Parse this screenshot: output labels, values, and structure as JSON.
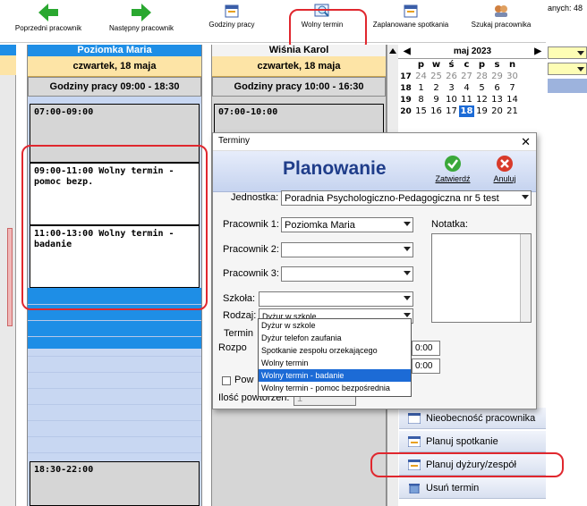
{
  "toolbar": {
    "prev_label": "Poprzedni pracownik",
    "next_label": "Następny pracownik",
    "hours_label": "Godziny pracy",
    "free_label": "Wolny termin",
    "planned_label": "Zaplanowane spotkania",
    "search_label": "Szukaj pracownika"
  },
  "user_count_fragment": "anych: 48",
  "columns": [
    {
      "name": "Poziomka Maria",
      "date": "czwartek, 18 maja",
      "hours": "Godziny pracy 09:00 - 18:30"
    },
    {
      "name": "Wiśnia Karol",
      "date": "czwartek, 18 maja",
      "hours": "Godziny pracy 10:00 - 16:30"
    }
  ],
  "slots": {
    "s1": "07:00-09:00",
    "s2": "09:00-11:00 Wolny termin - pomoc bezp.",
    "s3": "11:00-13:00 Wolny termin - badanie",
    "s4": "18:30-22:00",
    "s5": "07:00-10:00"
  },
  "calendar": {
    "month": "maj 2023",
    "day_headers": [
      "p",
      "w",
      "ś",
      "c",
      "p",
      "s",
      "n"
    ],
    "weeks": [
      {
        "wk": "17",
        "days": [
          "24",
          "25",
          "26",
          "27",
          "28",
          "29",
          "30"
        ]
      },
      {
        "wk": "18",
        "days": [
          "1",
          "2",
          "3",
          "4",
          "5",
          "6",
          "7"
        ]
      },
      {
        "wk": "19",
        "days": [
          "8",
          "9",
          "10",
          "11",
          "12",
          "13",
          "14"
        ]
      },
      {
        "wk": "20",
        "days": [
          "15",
          "16",
          "17",
          "18",
          "19",
          "20",
          "21"
        ]
      }
    ],
    "selected": "18"
  },
  "dialog": {
    "window_title": "Terminy",
    "heading": "Planowanie",
    "ok_label": "Zatwierdź",
    "cancel_label": "Anuluj",
    "unit_label": "Jednostka:",
    "unit_value": "Poradnia Psychologiczno-Pedagogiczna nr 5 test",
    "emp1_label": "Pracownik 1:",
    "emp1_value": "Poziomka Maria",
    "emp2_label": "Pracownik 2:",
    "emp3_label": "Pracownik 3:",
    "note_label": "Notatka:",
    "school_label": "Szkoła:",
    "type_label": "Rodzaj:",
    "type_value": "Dyżur w szkole",
    "term_label": "Termin",
    "start_label": "Rozpo",
    "time1": "0:00",
    "time2": "0:00",
    "repeat_label": "Pow",
    "count_label": "Ilość powtórzeń:",
    "count_value": "1"
  },
  "type_options": [
    "Dyżur w szkole",
    "Dyżur telefon zaufania",
    "Spotkanie zespołu orzekającego",
    "Wolny termin",
    "Wolny termin - badanie",
    "Wolny termin - pomoc bezpośrednia"
  ],
  "type_selected_index": 4,
  "side_menu": {
    "absence": "Nieobecność pracownika",
    "plan_meeting": "Planuj spotkanie",
    "plan_duty": "Planuj dyżury/zespół",
    "delete": "Usuń termin"
  },
  "colors": {
    "accent_blue": "#1e8ee6",
    "highlight_red": "#e0272e",
    "selection": "#1c6bd6"
  }
}
